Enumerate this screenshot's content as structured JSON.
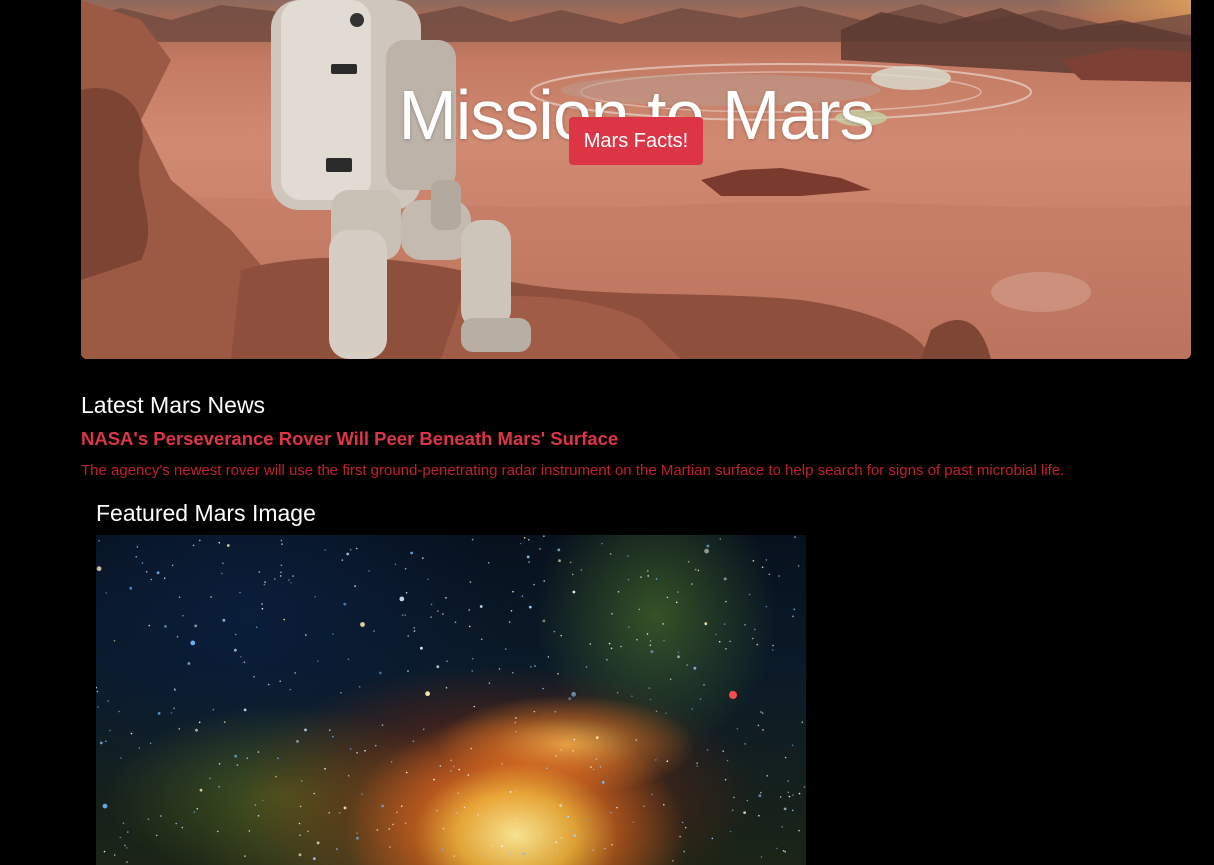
{
  "hero": {
    "title": "Mission to Mars",
    "button_label": "Mars Facts!"
  },
  "news": {
    "section_heading": "Latest Mars News",
    "title": "NASA's Perseverance Rover Will Peer Beneath Mars' Surface",
    "teaser": "The agency's newest rover will use the first ground-penetrating radar instrument on the Martian surface to help search for signs of past microbial life."
  },
  "featured": {
    "section_heading": "Featured Mars Image"
  },
  "colors": {
    "background": "#000000",
    "accent": "#dc3545",
    "heading_text": "#ffffff",
    "teaser_text": "#c0202e"
  }
}
